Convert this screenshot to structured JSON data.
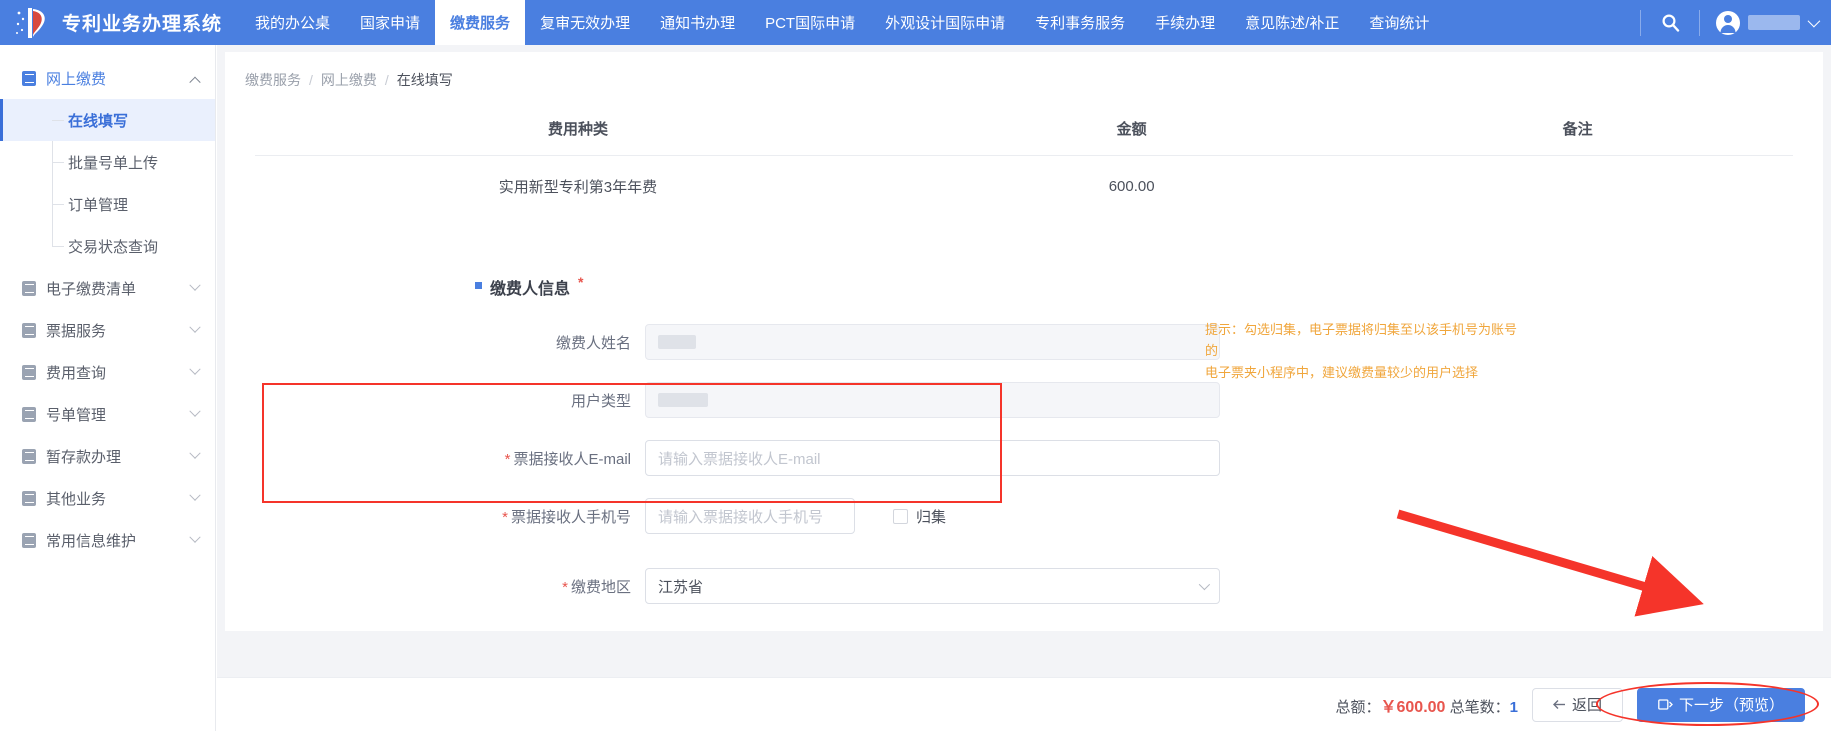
{
  "header": {
    "brand_title": "专利业务办理系统",
    "nav": [
      {
        "label": "我的办公桌",
        "active": false
      },
      {
        "label": "国家申请",
        "active": false
      },
      {
        "label": "缴费服务",
        "active": true
      },
      {
        "label": "复审无效办理",
        "active": false
      },
      {
        "label": "通知书办理",
        "active": false
      },
      {
        "label": "PCT国际申请",
        "active": false
      },
      {
        "label": "外观设计国际申请",
        "active": false
      },
      {
        "label": "专利事务服务",
        "active": false
      },
      {
        "label": "手续办理",
        "active": false
      },
      {
        "label": "意见陈述/补正",
        "active": false
      },
      {
        "label": "查询统计",
        "active": false
      }
    ],
    "search_icon": "search-icon",
    "user_icon": "user-avatar-icon",
    "user_name": "",
    "chevron_icon": "chevron-down-icon",
    "brand_color": "#4a7fe0"
  },
  "sidebar": {
    "groups": [
      {
        "label": "网上缴费",
        "icon": "online-payment-icon",
        "expanded": true,
        "children": [
          {
            "label": "在线填写",
            "active": true
          },
          {
            "label": "批量号单上传",
            "active": false
          },
          {
            "label": "订单管理",
            "active": false
          },
          {
            "label": "交易状态查询",
            "active": false
          }
        ]
      },
      {
        "label": "电子缴费清单",
        "icon": "e-list-icon",
        "expanded": false,
        "children": []
      },
      {
        "label": "票据服务",
        "icon": "invoice-icon",
        "expanded": false,
        "children": []
      },
      {
        "label": "费用查询",
        "icon": "fee-query-icon",
        "expanded": false,
        "children": []
      },
      {
        "label": "号单管理",
        "icon": "order-manage-icon",
        "expanded": false,
        "children": []
      },
      {
        "label": "暂存款办理",
        "icon": "deposit-icon",
        "expanded": false,
        "children": []
      },
      {
        "label": "其他业务",
        "icon": "other-business-icon",
        "expanded": false,
        "children": []
      },
      {
        "label": "常用信息维护",
        "icon": "common-info-icon",
        "expanded": false,
        "children": []
      }
    ]
  },
  "breadcrumb": {
    "items": [
      "缴费服务",
      "网上缴费",
      "在线填写"
    ],
    "separator": "/"
  },
  "fee_table": {
    "headers": [
      "费用种类",
      "金额",
      "备注"
    ],
    "rows": [
      {
        "fee_type": "实用新型专利第3年年费",
        "amount": "600.00",
        "remark": ""
      }
    ]
  },
  "form": {
    "section_title": "缴费人信息",
    "section_required_mark": "*",
    "fields": [
      {
        "label": "缴费人姓名",
        "required": false,
        "readonly": true,
        "value": "",
        "placeholder": "",
        "redacted": true
      },
      {
        "label": "用户类型",
        "required": false,
        "readonly": true,
        "value": "",
        "placeholder": "",
        "redacted": true
      },
      {
        "label": "票据接收人E-mail",
        "required": true,
        "readonly": false,
        "value": "",
        "placeholder": "请输入票据接收人E-mail",
        "redacted": false
      },
      {
        "label": "票据接收人手机号",
        "required": true,
        "readonly": false,
        "value": "",
        "placeholder": "请输入票据接收人手机号",
        "redacted": false
      }
    ],
    "checkbox": {
      "label": "归集",
      "checked": false
    },
    "hint_line_1": "提示：勾选归集，电子票据将归集至以该手机号为账号的",
    "hint_line_2": "电子票夹小程序中，建议缴费量较少的用户选择",
    "hint_color": "#f0a63c",
    "region": {
      "label": "缴费地区",
      "required": true,
      "value": "江苏省",
      "chevron_icon": "chevron-down-icon"
    }
  },
  "footer": {
    "total_label": "总额：",
    "currency": "￥",
    "total_amount": "600.00",
    "count_label": "总笔数：",
    "count_value": "1",
    "back_button": {
      "label": "返回",
      "icon": "arrow-left-icon"
    },
    "next_button": {
      "label": "下一步（预览）",
      "icon": "preview-icon"
    }
  },
  "annotations": {
    "highlight_box_color": "#f5342a",
    "arrow_color": "#f5342a"
  }
}
